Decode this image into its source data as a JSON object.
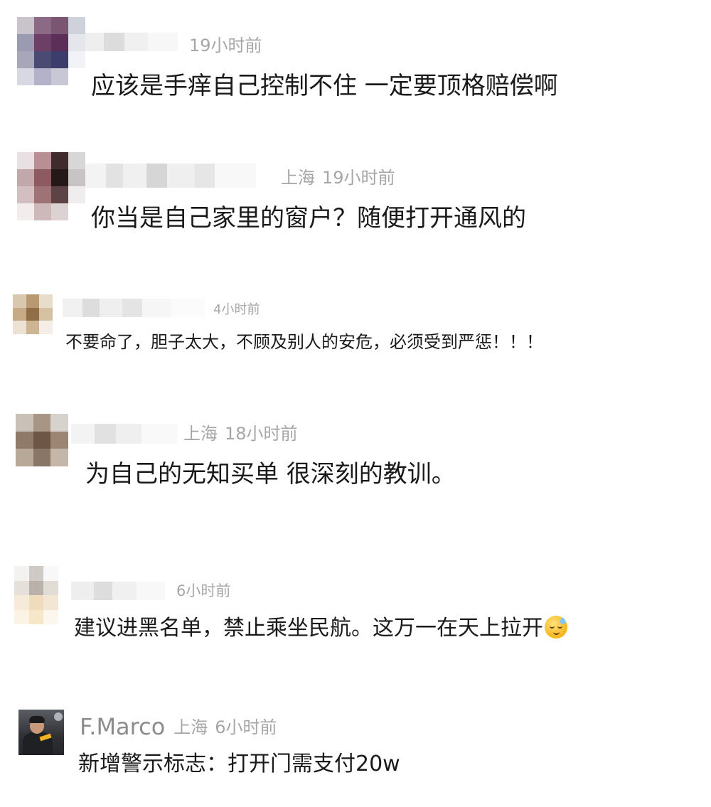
{
  "comments": [
    {
      "location": "",
      "time": "19小时前",
      "text": "应该是手痒自己控制不住 一定要顶格赔偿啊"
    },
    {
      "location": "上海",
      "time": "19小时前",
      "text": "你当是自己家里的窗户？随便打开通风的"
    },
    {
      "location": "",
      "time": "4小时前",
      "text": "不要命了，胆子太大，不顾及别人的安危，必须受到严惩！！！"
    },
    {
      "location": "上海",
      "time": "18小时前",
      "text": "为自己的无知买单 很深刻的教训。"
    },
    {
      "location": "",
      "time": "6小时前",
      "text": "建议进黑名单，禁止乘坐民航。这万一在天上拉开",
      "emoji": "cold-sweat-emoji-icon"
    },
    {
      "username": "F.Marco",
      "location": "上海",
      "time": "6小时前",
      "text": "新增警示标志：打开门需支付20w"
    }
  ]
}
